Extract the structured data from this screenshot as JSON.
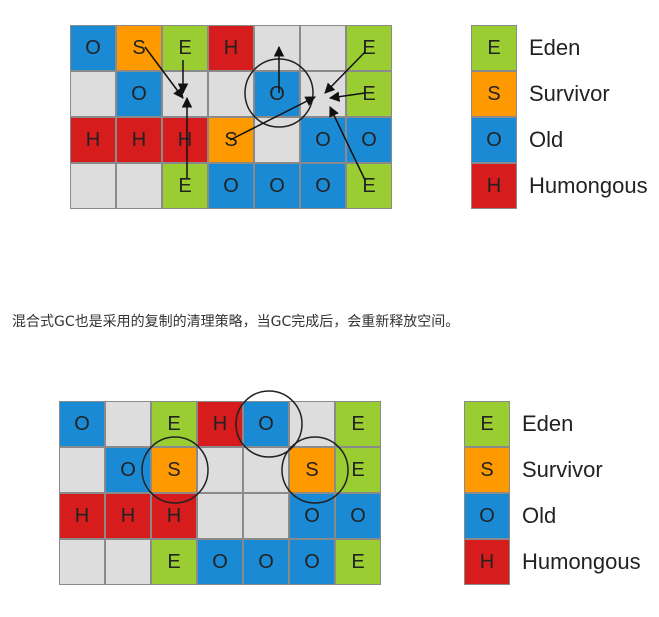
{
  "colors": {
    "E": "#9acd32",
    "S": "#ff9900",
    "O": "#1a8ad4",
    "H": "#d61c1c",
    "empty": "#dddddd"
  },
  "legend": [
    {
      "code": "E",
      "label": "Eden"
    },
    {
      "code": "S",
      "label": "Survivor"
    },
    {
      "code": "O",
      "label": "Old"
    },
    {
      "code": "H",
      "label": "Humongous"
    }
  ],
  "caption": "混合式GC也是采用的复制的清理策略，当GC完成后，会重新释放空间。",
  "diagram_before": {
    "rows": [
      [
        "O",
        "S",
        "E",
        "H",
        "",
        "",
        "E"
      ],
      [
        "",
        "O",
        "",
        "",
        "O",
        "",
        "E"
      ],
      [
        "H",
        "H",
        "H",
        "S",
        "",
        "O",
        "O"
      ],
      [
        "",
        "",
        "E",
        "O",
        "O",
        "O",
        "E"
      ]
    ]
  },
  "diagram_after": {
    "rows": [
      [
        "O",
        "",
        "E",
        "H",
        "O",
        "",
        "E"
      ],
      [
        "",
        "O",
        "S",
        "",
        "",
        "S",
        "E"
      ],
      [
        "H",
        "H",
        "H",
        "",
        "",
        "O",
        "O"
      ],
      [
        "",
        "",
        "E",
        "O",
        "O",
        "O",
        "E"
      ]
    ]
  }
}
